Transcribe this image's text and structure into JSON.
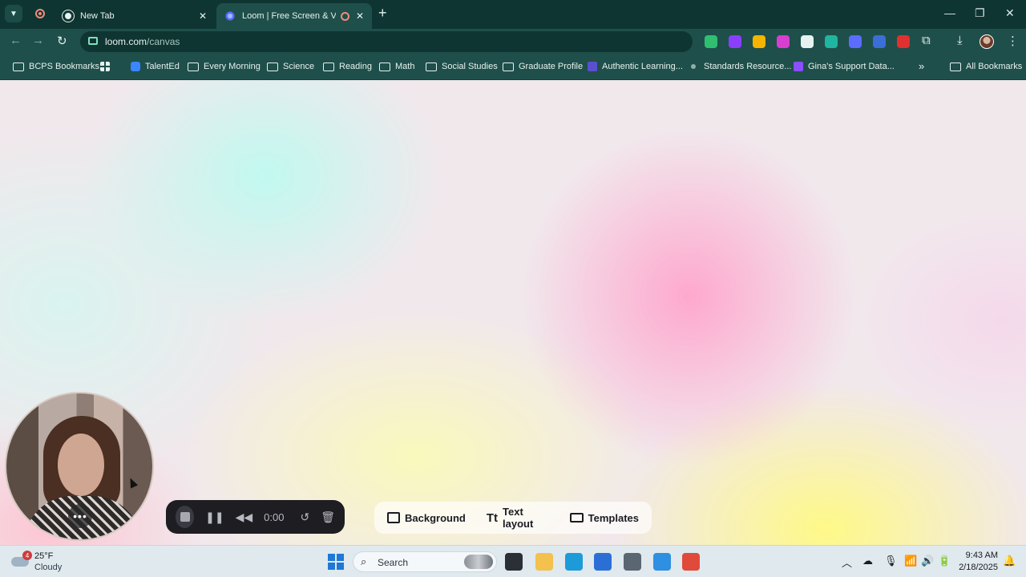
{
  "browser": {
    "tabs": [
      {
        "title": "New Tab",
        "close": "✕"
      },
      {
        "title": "Loom | Free Screen & Video Recording",
        "close": "✕"
      }
    ],
    "new_tab": "+",
    "window_controls": {
      "minimize": "—",
      "maximize": "❐",
      "close": "✕"
    },
    "nav": {
      "back": "←",
      "forward": "→",
      "reload": "↻"
    },
    "address": {
      "host": "loom.com",
      "path": "/canvas"
    },
    "bookmark_star": "☆",
    "toolbar_glyphs": {
      "extensions": "⧉",
      "download": "⤓",
      "menu": "⋮"
    },
    "bookmarks": [
      {
        "label": "BCPS Bookmarks",
        "icon": "folder-icon"
      },
      {
        "label": "",
        "icon": "apps-grid-icon"
      },
      {
        "label": "TalentEd",
        "icon": "talented-icon"
      },
      {
        "label": "Every Morning",
        "icon": "folder-icon"
      },
      {
        "label": "Science",
        "icon": "folder-icon"
      },
      {
        "label": "Reading",
        "icon": "folder-icon"
      },
      {
        "label": "Math",
        "icon": "folder-icon"
      },
      {
        "label": "Social Studies",
        "icon": "folder-icon"
      },
      {
        "label": "Graduate Profile",
        "icon": "folder-icon"
      },
      {
        "label": "Authentic Learning...",
        "icon": "authentic-learning-icon"
      },
      {
        "label": "Standards Resource...",
        "icon": "standards-icon"
      },
      {
        "label": "Gina's Support Data...",
        "icon": "list-icon"
      }
    ],
    "bookmarks_more": "»",
    "all_bookmarks": "All Bookmarks",
    "extension_colors": [
      "#2fbf71",
      "#8a3ffc",
      "#f4b400",
      "#d63fd0",
      "#e6f2ef",
      "#1fb5a0",
      "#5b6cff",
      "#3a6fd8",
      "#e03030"
    ]
  },
  "loom": {
    "camera_more": "•••",
    "controls": {
      "timer": "0:00",
      "pause": "❚❚",
      "rewind": "◀◀",
      "restart": "↺",
      "delete": "🗑"
    },
    "tools": [
      {
        "label": "Background",
        "icon": "image-icon"
      },
      {
        "label": "Text layout",
        "icon": "text-layout-icon",
        "glyph": "Tt"
      },
      {
        "label": "Templates",
        "icon": "monitor-icon"
      }
    ]
  },
  "taskbar": {
    "weather": {
      "badge": "4",
      "temp": "25°F",
      "condition": "Cloudy"
    },
    "search": "Search",
    "search_glyph": "⌕",
    "apps": [
      {
        "name": "task-view",
        "color": "#2b2f36"
      },
      {
        "name": "file-explorer",
        "color": "#f2c14e"
      },
      {
        "name": "edge",
        "color": "#1d9bd8"
      },
      {
        "name": "store",
        "color": "#2b6fd6"
      },
      {
        "name": "calculator",
        "color": "#5a6672"
      },
      {
        "name": "notepad",
        "color": "#2f8fe0"
      },
      {
        "name": "chrome",
        "color": "#e04a3a"
      }
    ],
    "tray": {
      "chevron": "︿",
      "onedrive": "☁",
      "mic": "🎙",
      "wifi": "📶",
      "volume": "🔊",
      "battery": "🔋"
    },
    "time": "9:43 AM",
    "date": "2/18/2025",
    "bell": "🔔"
  }
}
